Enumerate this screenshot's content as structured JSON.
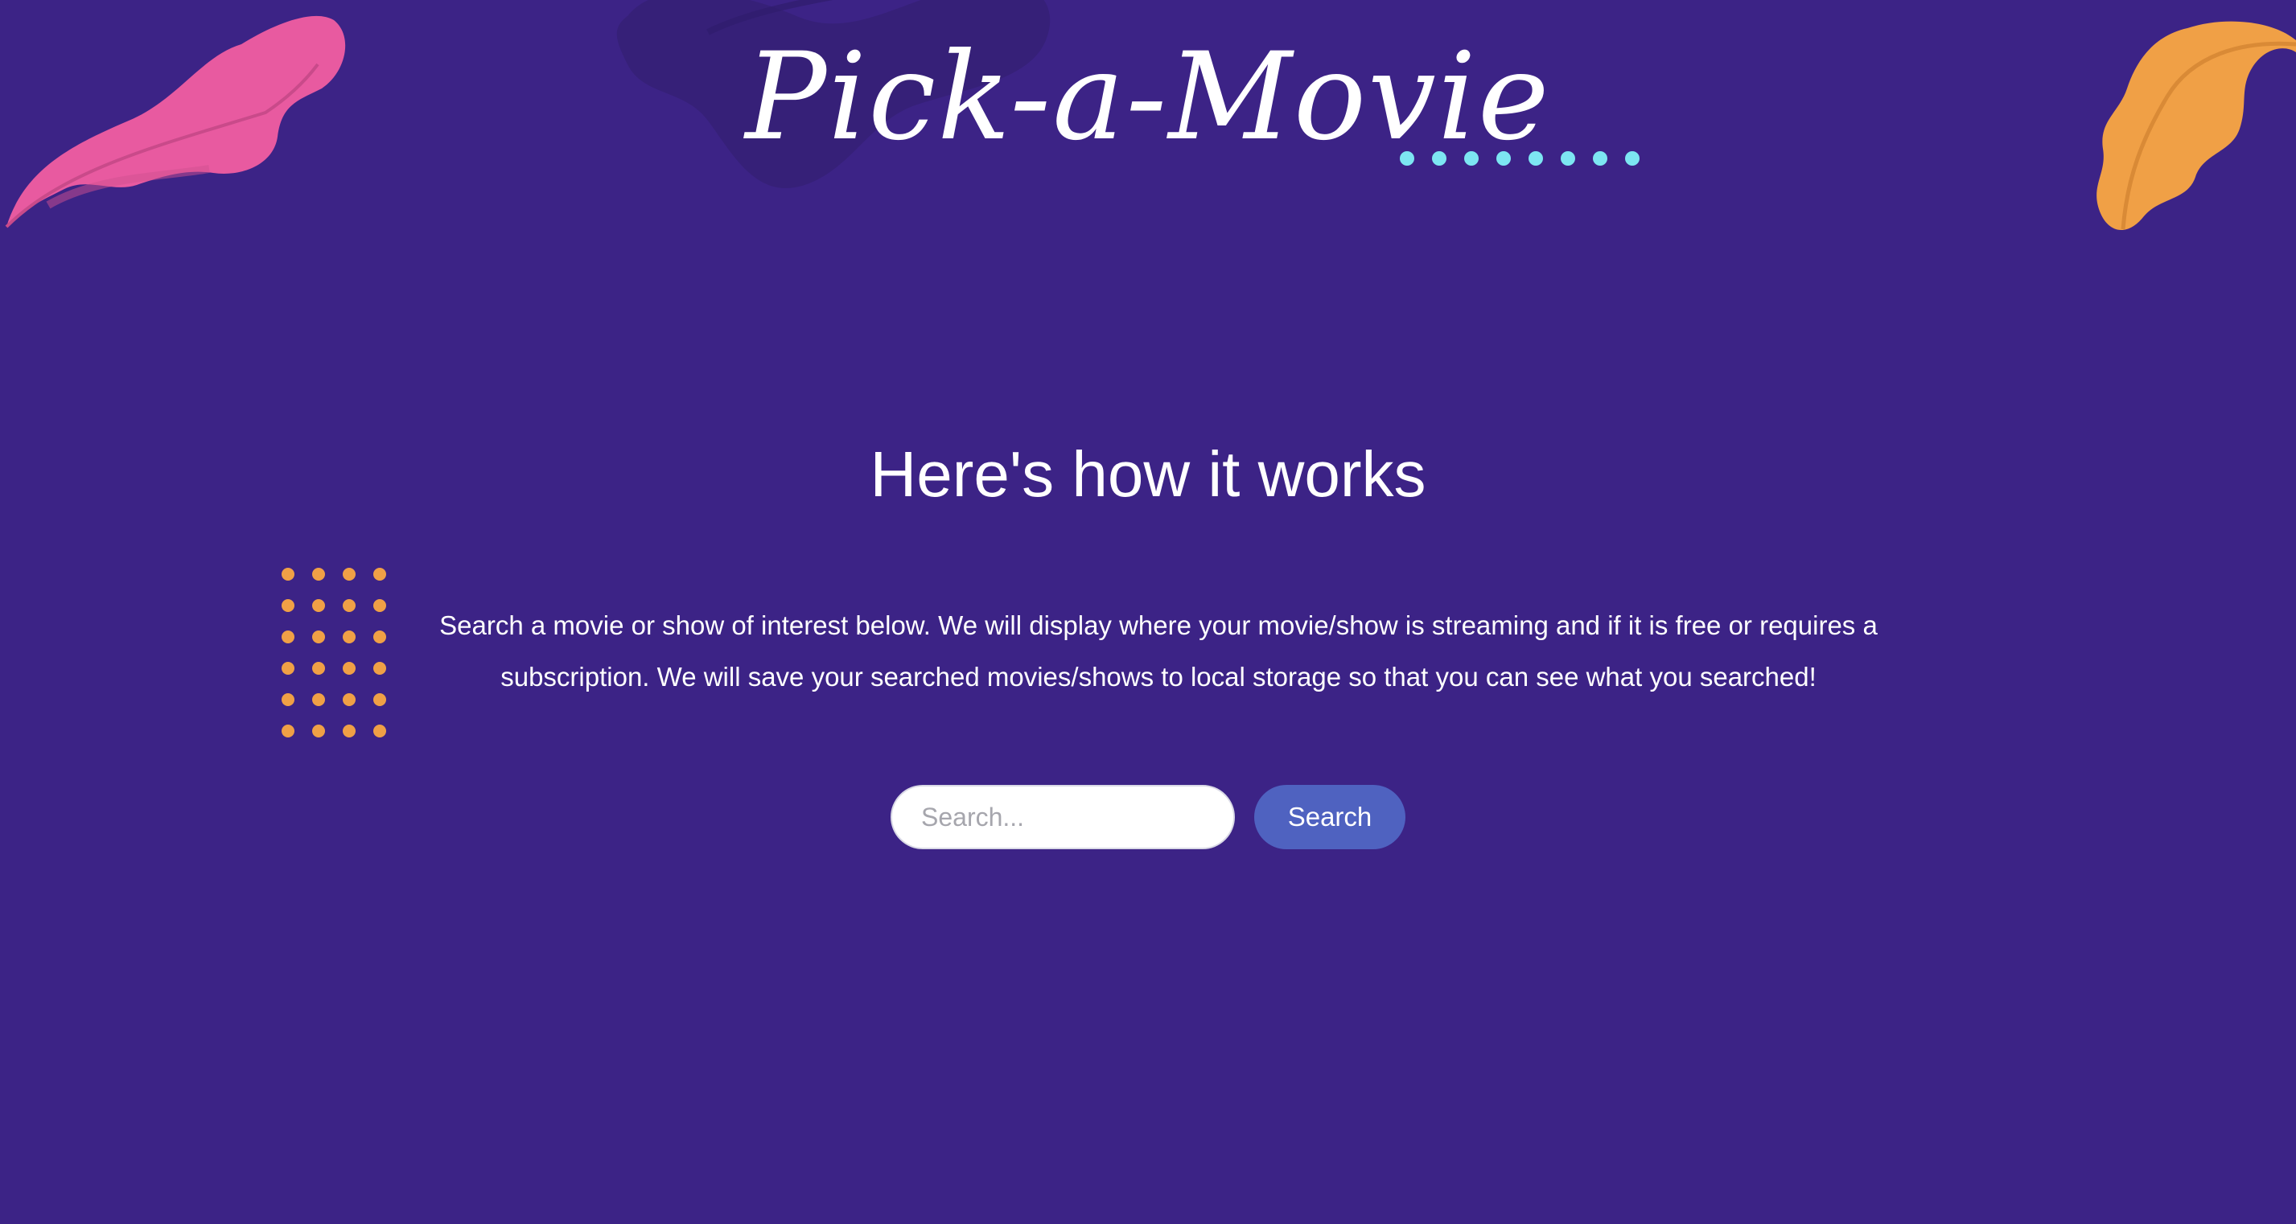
{
  "header": {
    "title": "Pick-a-Movie"
  },
  "main": {
    "heading": "Here's how it works",
    "description": "Search a movie or show of interest below. We will display where your movie/show is streaming and if it is free or requires a subscription. We will save your searched movies/shows to local storage so that you can see what you searched!"
  },
  "search": {
    "placeholder": "Search...",
    "value": "",
    "button_label": "Search"
  },
  "colors": {
    "background": "#3c2386",
    "accent_button": "#4f62c0",
    "pink_leaf": "#e85aa0",
    "orange_leaf": "#f0a046",
    "cyan_dots": "#7de6f2",
    "orange_dots": "#f0a046"
  },
  "decorations": {
    "left_leaf_icon": "pink-leaf-icon",
    "right_leaf_icon": "orange-leaf-icon"
  }
}
